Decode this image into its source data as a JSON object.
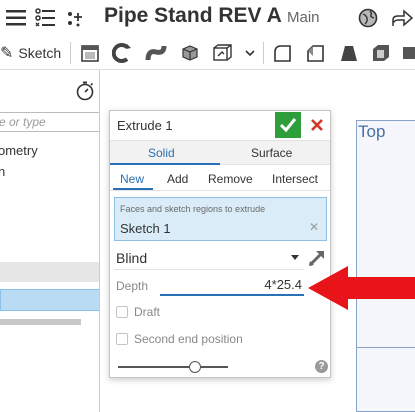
{
  "document": {
    "title": "Pipe Stand REV A",
    "branch": "Main"
  },
  "toolbar": {
    "sketch_label": "Sketch"
  },
  "feature_tree": {
    "filter_placeholder": "e or type",
    "items": [
      "ometry",
      "n"
    ]
  },
  "extrude_dialog": {
    "title": "Extrude 1",
    "body_types": [
      "Solid",
      "Surface"
    ],
    "active_body_type": "Solid",
    "operations": [
      "New",
      "Add",
      "Remove",
      "Intersect"
    ],
    "active_operation": "New",
    "selection_hint": "Faces and sketch regions to extrude",
    "selection_value": "Sketch 1",
    "end_type": "Blind",
    "depth_label": "Depth",
    "depth_value": "4*25.4",
    "draft_label": "Draft",
    "second_end_label": "Second end position"
  },
  "viewport": {
    "view_label": "Top"
  },
  "colors": {
    "accent": "#2b6fb4",
    "ok_green": "#2e9e3a",
    "cancel_red": "#d4352a",
    "selection_fill": "#d9ecf8",
    "annotation_arrow": "#e8141a"
  },
  "icons": {
    "top_bar": [
      "menu-icon",
      "feature-list-icon",
      "variables-icon",
      "globe-icon",
      "share-icon"
    ],
    "toolbar": [
      "pencil-icon",
      "new-part-studio-icon",
      "revolve-icon",
      "sweep-icon",
      "loft-icon",
      "solid-box-icon",
      "fillet-icon",
      "chamfer-icon",
      "draft-icon",
      "shell-icon"
    ]
  }
}
